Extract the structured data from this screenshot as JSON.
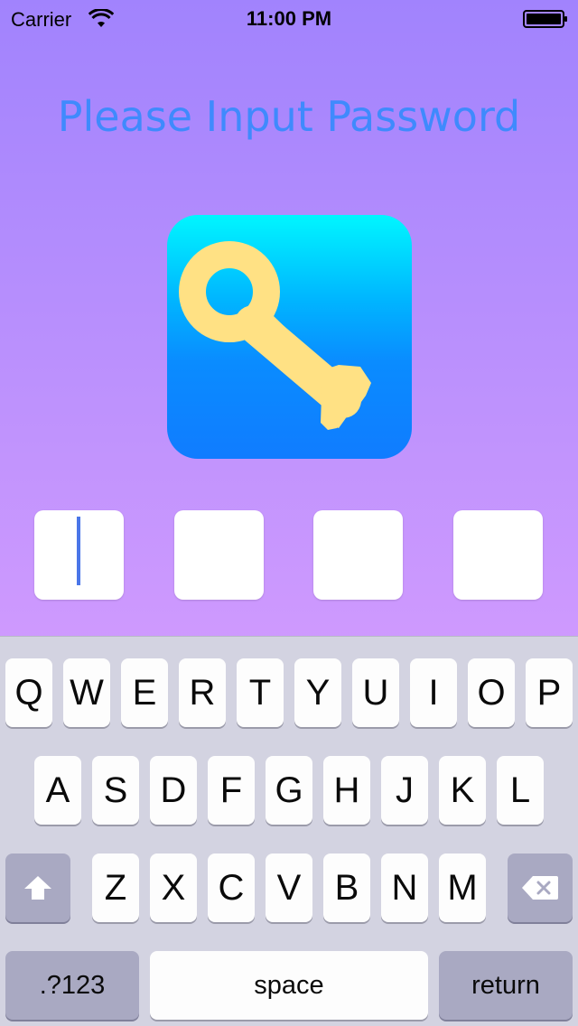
{
  "status_bar": {
    "carrier": "Carrier",
    "time": "11:00 PM",
    "wifi_icon": "wifi-icon",
    "battery_icon": "battery-icon"
  },
  "title": "Please Input Password",
  "app_icon": {
    "icon": "key-icon",
    "gradient_top": "#00f6ff",
    "gradient_bottom": "#107cff",
    "key_color": "#ffe184"
  },
  "password": {
    "digits": 4,
    "entered": 0,
    "cursor_color": "#4a76e8"
  },
  "keyboard": {
    "row1": [
      "Q",
      "W",
      "E",
      "R",
      "T",
      "Y",
      "U",
      "I",
      "O",
      "P"
    ],
    "row2": [
      "A",
      "S",
      "D",
      "F",
      "G",
      "H",
      "J",
      "K",
      "L"
    ],
    "row3": [
      "Z",
      "X",
      "C",
      "V",
      "B",
      "N",
      "M"
    ],
    "shift_icon": "shift-icon",
    "delete_icon": "delete-icon",
    "numbers_label": ".?123",
    "space_label": "space",
    "return_label": "return"
  },
  "colors": {
    "title": "#3f8afd",
    "background_top": "#a183fd",
    "background_bottom": "#d19cff",
    "keyboard_bg": "#d3d3e1"
  }
}
